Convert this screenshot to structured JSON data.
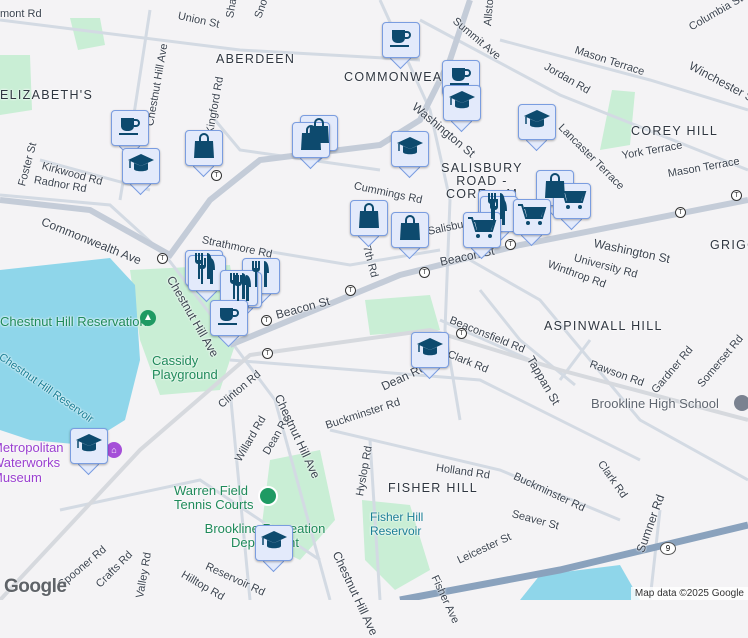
{
  "map": {
    "neighborhoods": [
      "ABERDEEN",
      "COMMONWEALTH",
      "ELIZABETH'S",
      "COREY HILL",
      "SALISBURY ROAD - CORE... M",
      "GRIGG",
      "ASPINWALL HILL",
      "FISHER HILL"
    ],
    "streets": [
      "Union St",
      "Shannon",
      "Snow",
      "Chestnut Hill Ave",
      "Kingford Rd",
      "Summit Ave",
      "Allston",
      "Columbia St",
      "Mason Terrace",
      "Jordan Rd",
      "Winchester St",
      "Washington St",
      "Lancaster Terrace",
      "York Terrace",
      "Foster St",
      "Kirkwood Rd",
      "Radnor Rd",
      "Commonwealth Ave",
      "Strathmore Rd",
      "Cummings Rd",
      "Salisbury Rd",
      "Beacon St",
      "University Rd",
      "Winthrop Rd",
      "Beaconsfield Rd",
      "Clark Rd",
      "Tappan St",
      "Rawson Rd",
      "Gardner Rd",
      "Somerset Rd",
      "Dean Rd",
      "Clinton Rd",
      "Buckminster Rd",
      "Willard Rd",
      "Hyslop Rd",
      "Holland Rd",
      "Seaver St",
      "Leicester St",
      "Sumner Rd",
      "Spooner Rd",
      "Crafts Rd",
      "Valley Rd",
      "Hilltop Rd",
      "Reservoir Rd",
      "Fisher Ave",
      "Chestnut Hill Ave",
      "mont Rd",
      "7th Rd"
    ],
    "places": {
      "reservation": "Chestnut Hill Reservation",
      "reservoir": "Chestnut Hill Reservoir",
      "playground": "Cassidy Playground",
      "museum": "Metropolitan Waterworks Museum",
      "tennis": "Warren Field Tennis Courts",
      "recreation": "Brookline Recreation Department",
      "high_school": "Brookline High School",
      "fisher_reservoir": "Fisher Hill Reservoir",
      "route": "9"
    },
    "attribution": "Map data ©2025 Google",
    "logo": "Google"
  },
  "colors": {
    "marker_bg": "#e3eafb",
    "marker_border": "#7a9de0",
    "icon": "#0d4a6e",
    "water": "#8fd6ea",
    "park": "#c4eccf"
  }
}
